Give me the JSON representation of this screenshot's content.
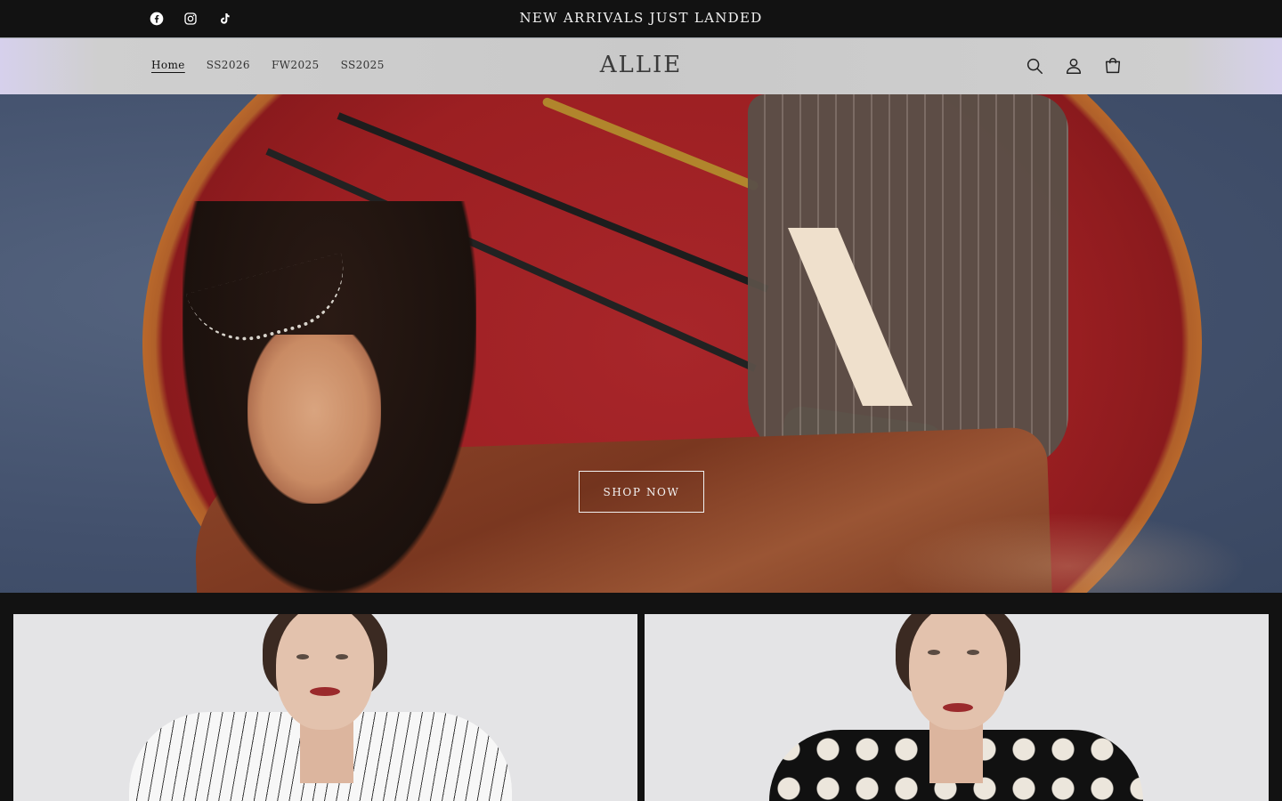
{
  "announcement": {
    "text": "NEW ARRIVALS JUST LANDED",
    "socials": [
      "facebook-icon",
      "instagram-icon",
      "tiktok-icon"
    ]
  },
  "header": {
    "logo": "ALLIE",
    "nav": [
      {
        "label": "Home",
        "active": true
      },
      {
        "label": "SS2026",
        "active": false
      },
      {
        "label": "FW2025",
        "active": false
      },
      {
        "label": "SS2025",
        "active": false
      }
    ],
    "icons": [
      "search-icon",
      "account-icon",
      "cart-icon"
    ]
  },
  "hero": {
    "cta": "SHOP NOW"
  },
  "products": [
    {
      "name": "pinstripe-look"
    },
    {
      "name": "polka-dot-look"
    }
  ],
  "colors": {
    "announcement_bg": "#121212",
    "header_bg": "#c9c9c9",
    "header_accent": "#d6d0ec",
    "page_bg": "#121212"
  }
}
